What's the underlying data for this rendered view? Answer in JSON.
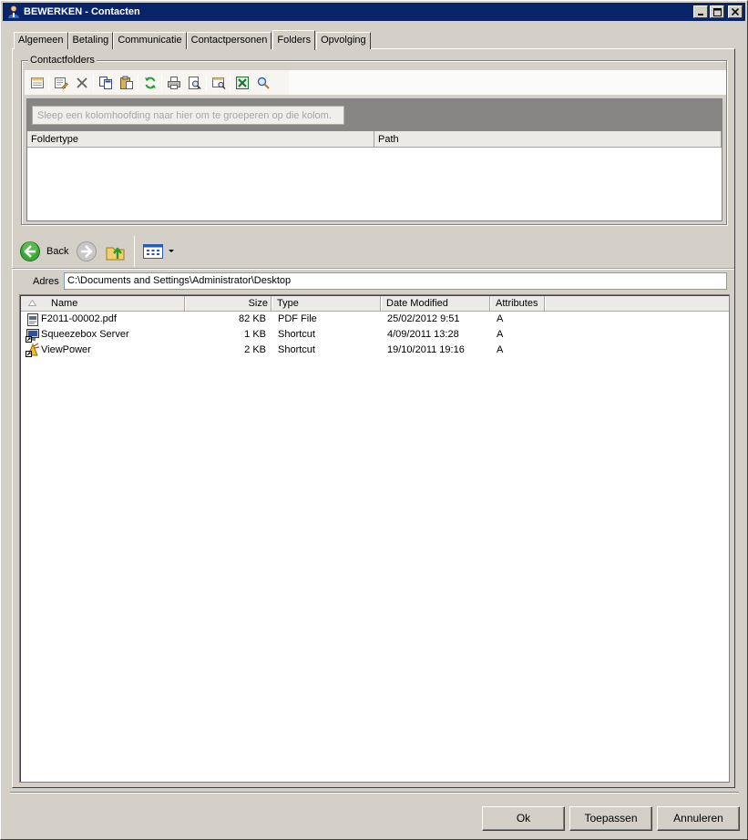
{
  "window": {
    "title": "BEWERKEN - Contacten",
    "icons": {
      "app": "contact-person-icon",
      "minimize": "minimize-icon",
      "maximize": "maximize-icon",
      "close": "close-icon"
    }
  },
  "tabs": [
    {
      "label": "Algemeen",
      "active": false
    },
    {
      "label": "Betaling",
      "active": false
    },
    {
      "label": "Communicatie",
      "active": false
    },
    {
      "label": "Contactpersonen",
      "active": false
    },
    {
      "label": "Folders",
      "active": true
    },
    {
      "label": "Opvolging",
      "active": false
    }
  ],
  "contactfolders": {
    "group_title": "Contactfolders",
    "toolbar_icons": [
      "new-record-icon",
      "edit-icon",
      "delete-icon",
      "copy-icon",
      "paste-icon",
      "refresh-icon",
      "print-icon",
      "print-preview-icon",
      "filter-icon",
      "excel-export-icon",
      "search-icon"
    ],
    "group_hint": "Sleep een kolomhoofding naar hier om te groeperen op die kolom.",
    "columns": [
      "Foldertype",
      "Path"
    ]
  },
  "explorer": {
    "back_label": "Back",
    "icons": {
      "back": "back-arrow-icon",
      "forward": "forward-arrow-icon",
      "up": "folder-up-icon",
      "views": "view-mode-icon",
      "views_dropdown": "chevron-down-icon"
    },
    "address_label": "Adres",
    "address_value": "C:\\Documents and Settings\\Administrator\\Desktop",
    "columns": {
      "name": "Name",
      "size": "Size",
      "type": "Type",
      "date": "Date Modified",
      "attributes": "Attributes"
    },
    "files": [
      {
        "name": "F2011-00002.pdf",
        "size": "82 KB",
        "type": "PDF File",
        "date": "25/02/2012 9:51",
        "attributes": "A",
        "icon": "pdf-file-icon"
      },
      {
        "name": "Squeezebox Server",
        "size": "1 KB",
        "type": "Shortcut",
        "date": "4/09/2011 13:28",
        "attributes": "A",
        "icon": "shortcut-icon"
      },
      {
        "name": "ViewPower",
        "size": "2 KB",
        "type": "Shortcut",
        "date": "19/10/2011 19:16",
        "attributes": "A",
        "icon": "shortcut-icon"
      }
    ]
  },
  "buttons": {
    "ok": "Ok",
    "apply": "Toepassen",
    "cancel": "Annuleren"
  }
}
